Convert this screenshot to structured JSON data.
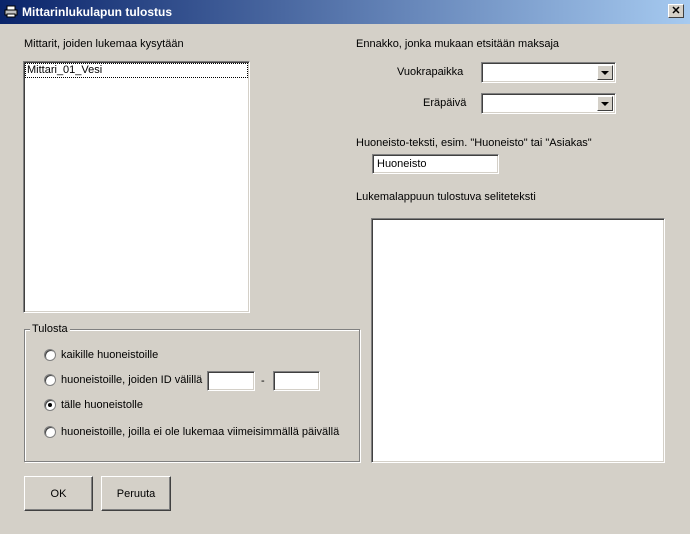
{
  "window": {
    "title": "Mittarinlukulapun tulostus",
    "close_glyph": "✕"
  },
  "meters": {
    "label": "Mittarit, joiden lukemaa kysytään",
    "items": [
      "Mittari_01_Vesi"
    ]
  },
  "advance": {
    "label": "Ennakko, jonka mukaan etsitään maksaja",
    "rent_label": "Vuokrapaikka",
    "rent_value": "",
    "due_label": "Eräpäivä",
    "due_value": ""
  },
  "apartment_text": {
    "label": "Huoneisto-teksti, esim. \"Huoneisto\" tai \"Asiakas\"",
    "value": "Huoneisto"
  },
  "explanation": {
    "label": "Lukemalappuun tulostuva seliteteksti",
    "value": ""
  },
  "print_group": {
    "label": "Tulosta",
    "option_all": "kaikille huoneistoille",
    "option_range": "huoneistoille, joiden ID välillä",
    "range_from": "",
    "range_sep": "-",
    "range_to": "",
    "option_this": "tälle huoneistolle",
    "option_noreading": "huoneistoille, joilla ei ole lukemaa viimeisimmällä päivällä",
    "selected": "this"
  },
  "buttons": {
    "ok": "OK",
    "cancel": "Peruuta"
  },
  "icons": {
    "title": "printer-icon",
    "dropdown": "chevron-down-icon"
  }
}
